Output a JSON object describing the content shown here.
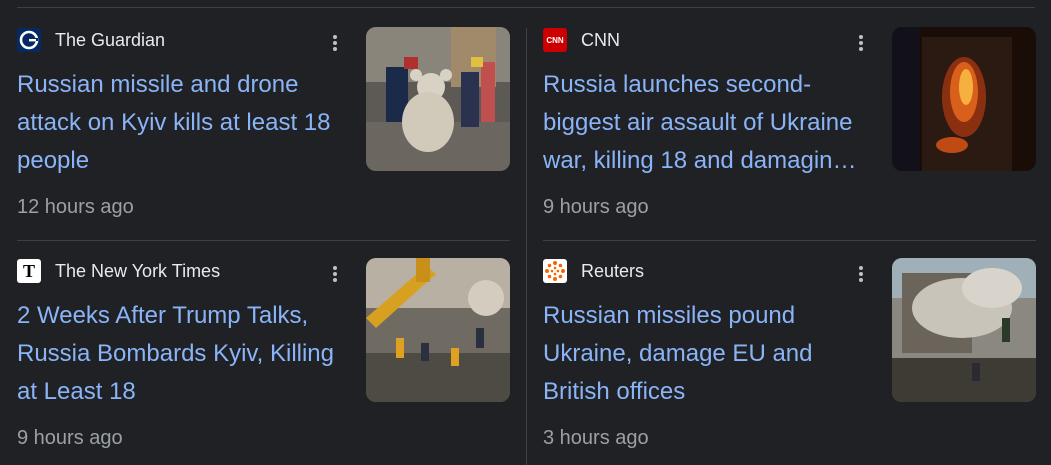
{
  "articles": [
    {
      "source": "The Guardian",
      "source_logo": "guardian-g-logo",
      "headline_lines": [
        "Russian missile and drone",
        "attack on Kyiv kills at least 18",
        "people"
      ],
      "time": "12 hours ago",
      "image": "rescue-workers-with-teddy-bear-image"
    },
    {
      "source": "CNN",
      "source_logo": "cnn-logo",
      "headline_lines": [
        "Russia launches second-",
        "biggest air assault of Ukraine",
        "war, killing 18 and damagin…"
      ],
      "time": "9 hours ago",
      "image": "burning-building-night-image"
    },
    {
      "source": "The New York Times",
      "source_logo": "nyt-t-logo",
      "headline_lines": [
        "2 Weeks After Trump Talks,",
        "Russia Bombards Kyiv, Killing",
        "at Least 18"
      ],
      "time": "9 hours ago",
      "image": "excavator-rubble-image"
    },
    {
      "source": "Reuters",
      "source_logo": "reuters-dots-logo",
      "headline_lines": [
        "Russian missiles pound",
        "Ukraine, damage EU and",
        "British offices"
      ],
      "time": "3 hours ago",
      "image": "smoking-ruined-building-image"
    }
  ],
  "colors": {
    "background": "#202124",
    "headline": "#8ab4f8",
    "source": "#e8eaed",
    "time": "#9aa0a6",
    "divider": "#3c4043"
  }
}
